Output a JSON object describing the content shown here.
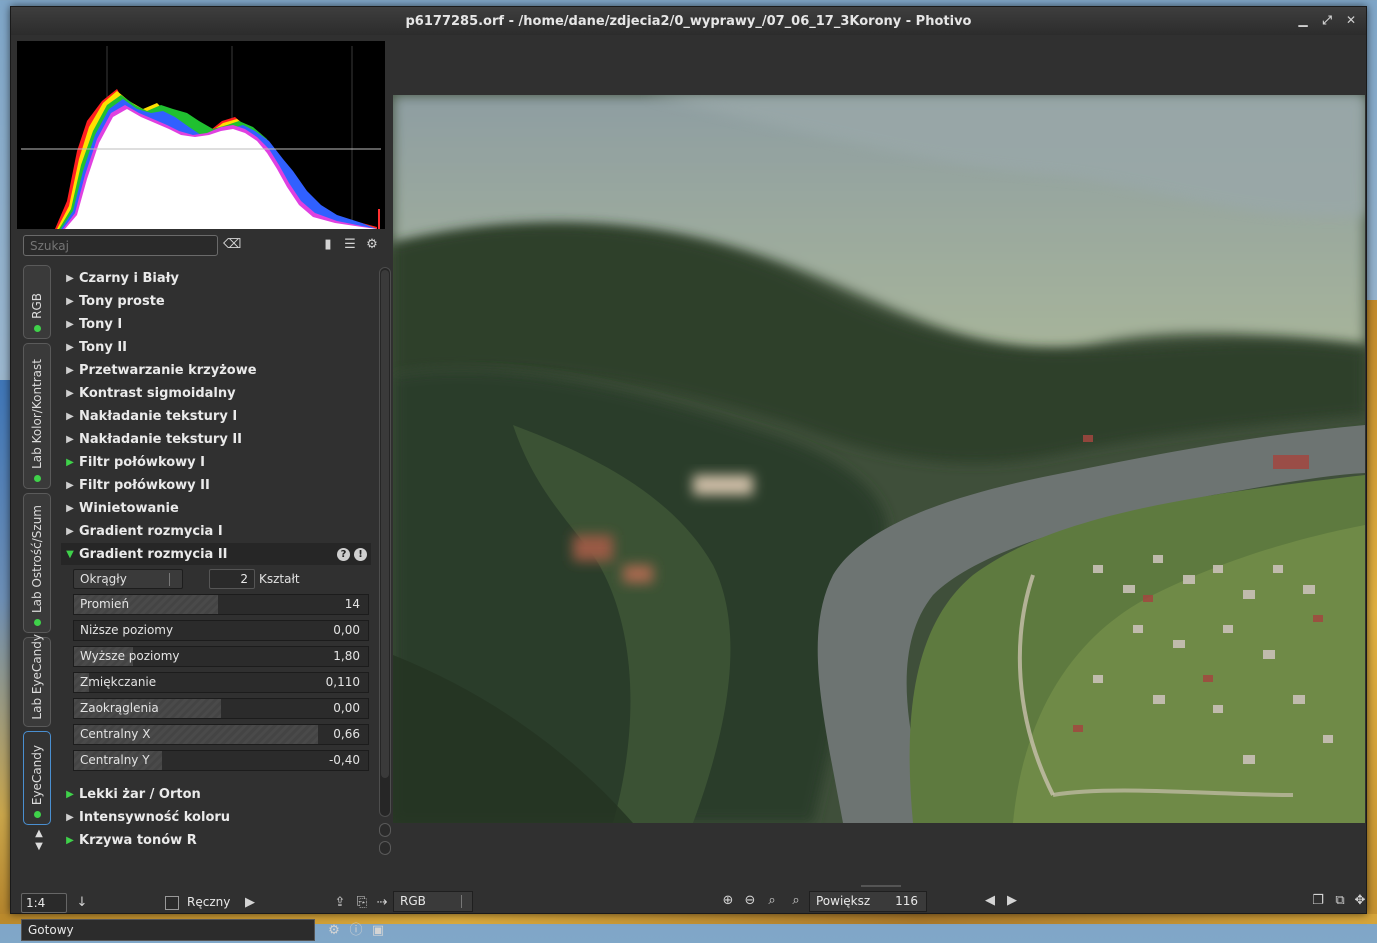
{
  "window": {
    "title": "p6177285.orf - /home/dane/zdjecia2/0_wyprawy_/07_06_17_3Korony - Photivo",
    "controls": {
      "minimize": "▁",
      "maximize": "⤢",
      "close": "✕"
    }
  },
  "search": {
    "placeholder": "Szukaj"
  },
  "tabs": [
    "RGB",
    "Lab Kolor/Kontrast",
    "Lab Ostrość/Szum",
    "Lab EyeCandy",
    "EyeCandy"
  ],
  "active_tab": "EyeCandy",
  "filters_before": [
    {
      "label": "Czarny i Biały",
      "active": false
    },
    {
      "label": "Tony proste",
      "active": false
    },
    {
      "label": "Tony I",
      "active": false
    },
    {
      "label": "Tony II",
      "active": false
    },
    {
      "label": "Przetwarzanie krzyżowe",
      "active": false
    },
    {
      "label": "Kontrast sigmoidalny",
      "active": false
    },
    {
      "label": "Nakładanie tekstury I",
      "active": false
    },
    {
      "label": "Nakładanie tekstury II",
      "active": false
    },
    {
      "label": "Filtr połówkowy I",
      "active": true
    },
    {
      "label": "Filtr połówkowy II",
      "active": false
    },
    {
      "label": "Winietowanie",
      "active": false
    },
    {
      "label": "Gradient rozmycia I",
      "active": false
    }
  ],
  "open_filter": {
    "label": "Gradient rozmycia II",
    "shape_value": "Okrągły",
    "spin_value": "2",
    "spin_label": "Kształt",
    "sliders": [
      {
        "label": "Promień",
        "value": "14",
        "fill": 0.49
      },
      {
        "label": "Niższe poziomy",
        "value": "0,00",
        "fill": 0.0
      },
      {
        "label": "Wyższe poziomy",
        "value": "1,80",
        "fill": 0.2
      },
      {
        "label": "Zmiękczanie",
        "value": "0,110",
        "fill": 0.05
      },
      {
        "label": "Zaokrąglenia",
        "value": "0,00",
        "fill": 0.5
      },
      {
        "label": "Centralny X",
        "value": "0,66",
        "fill": 0.83
      },
      {
        "label": "Centralny Y",
        "value": "-0,40",
        "fill": 0.3
      }
    ]
  },
  "filters_after": [
    {
      "label": "Lekki żar / Orton",
      "active": true
    },
    {
      "label": "Intensywność koloru",
      "active": false
    },
    {
      "label": "Krzywa tonów R",
      "active": true
    }
  ],
  "bottom_left": {
    "zoom": "1:4",
    "manual_label": "Ręczny"
  },
  "status": "Gotowy",
  "view": {
    "channel": "RGB",
    "zoom_label": "Powiększ",
    "zoom_value": "116"
  }
}
